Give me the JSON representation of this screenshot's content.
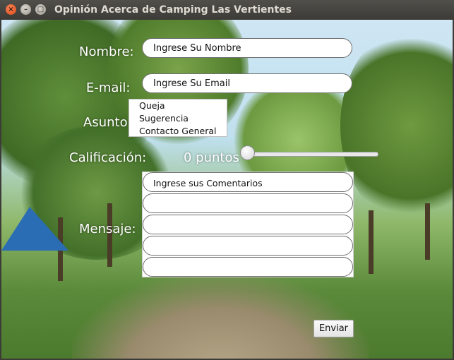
{
  "window": {
    "title": "Opinión Acerca de Camping Las Vertientes",
    "close_glyph": "×",
    "min_glyph": "–",
    "max_glyph": "□"
  },
  "form": {
    "nombre_label": "Nombre:",
    "nombre_value": "Ingrese Su Nombre",
    "email_label": "E-mail:",
    "email_value": "Ingrese Su Email",
    "asunto_label": "Asunto",
    "asunto_options": [
      "Queja",
      "Sugerencia",
      "Contacto General"
    ],
    "calificacion_label": "Calificación:",
    "puntos_text": "0 puntos",
    "slider_value": 0,
    "mensaje_label": "Mensaje:",
    "comentarios_value": "Ingrese sus Comentarios",
    "enviar_label": "Enviar"
  },
  "icons": [
    "close-icon",
    "minimize-icon",
    "maximize-icon"
  ],
  "colors": {
    "titlebar": "#3c3b37",
    "title_text": "#dfdbd2",
    "close_button": "#df4a16",
    "label_text": "#ffffff"
  }
}
